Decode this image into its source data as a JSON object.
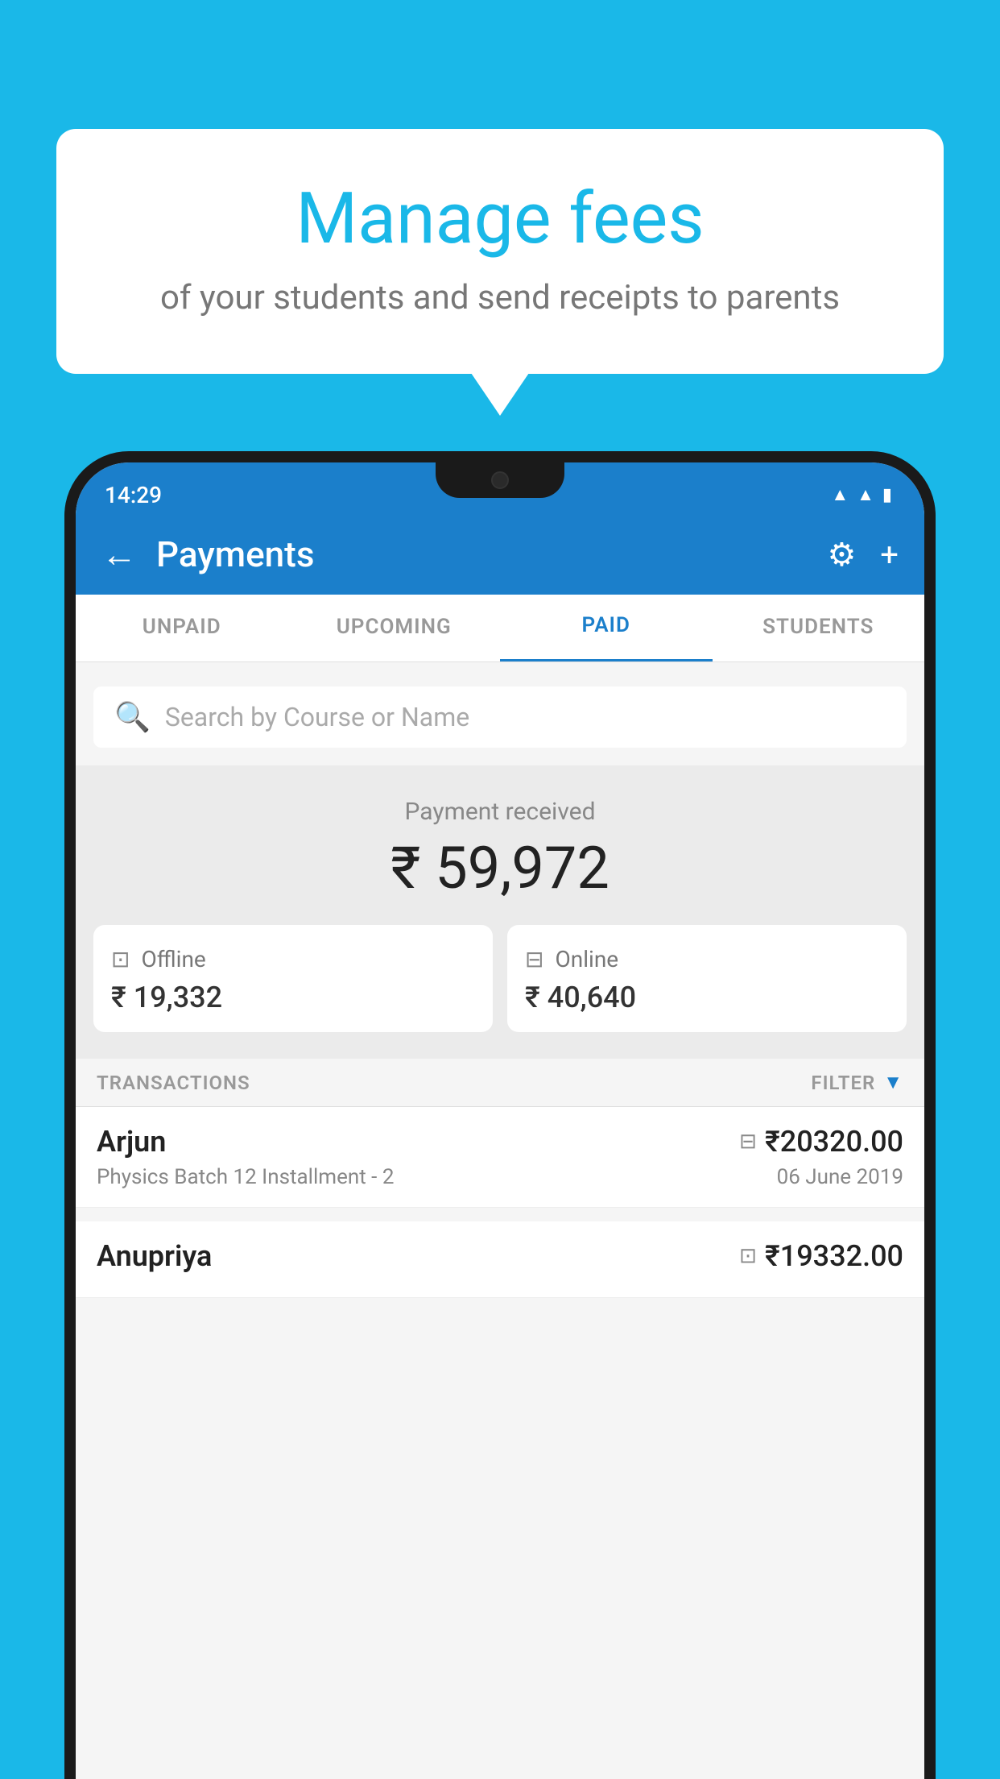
{
  "background_color": "#1ab8e8",
  "bubble": {
    "title": "Manage fees",
    "subtitle": "of your students and send receipts to parents"
  },
  "status_bar": {
    "time": "14:29",
    "icons": [
      "wifi",
      "signal",
      "battery"
    ]
  },
  "app_bar": {
    "title": "Payments",
    "back_label": "←",
    "gear_label": "⚙",
    "plus_label": "+"
  },
  "tabs": [
    {
      "label": "UNPAID",
      "active": false
    },
    {
      "label": "UPCOMING",
      "active": false
    },
    {
      "label": "PAID",
      "active": true
    },
    {
      "label": "STUDENTS",
      "active": false
    }
  ],
  "search": {
    "placeholder": "Search by Course or Name"
  },
  "payment": {
    "label": "Payment received",
    "amount": "₹ 59,972",
    "offline_label": "Offline",
    "offline_amount": "₹ 19,332",
    "online_label": "Online",
    "online_amount": "₹ 40,640"
  },
  "transactions": {
    "header": "TRANSACTIONS",
    "filter_label": "FILTER",
    "items": [
      {
        "name": "Arjun",
        "description": "Physics Batch 12 Installment - 2",
        "amount": "₹20320.00",
        "date": "06 June 2019",
        "payment_type": "online"
      },
      {
        "name": "Anupriya",
        "description": "",
        "amount": "₹19332.00",
        "date": "",
        "payment_type": "offline"
      }
    ]
  }
}
